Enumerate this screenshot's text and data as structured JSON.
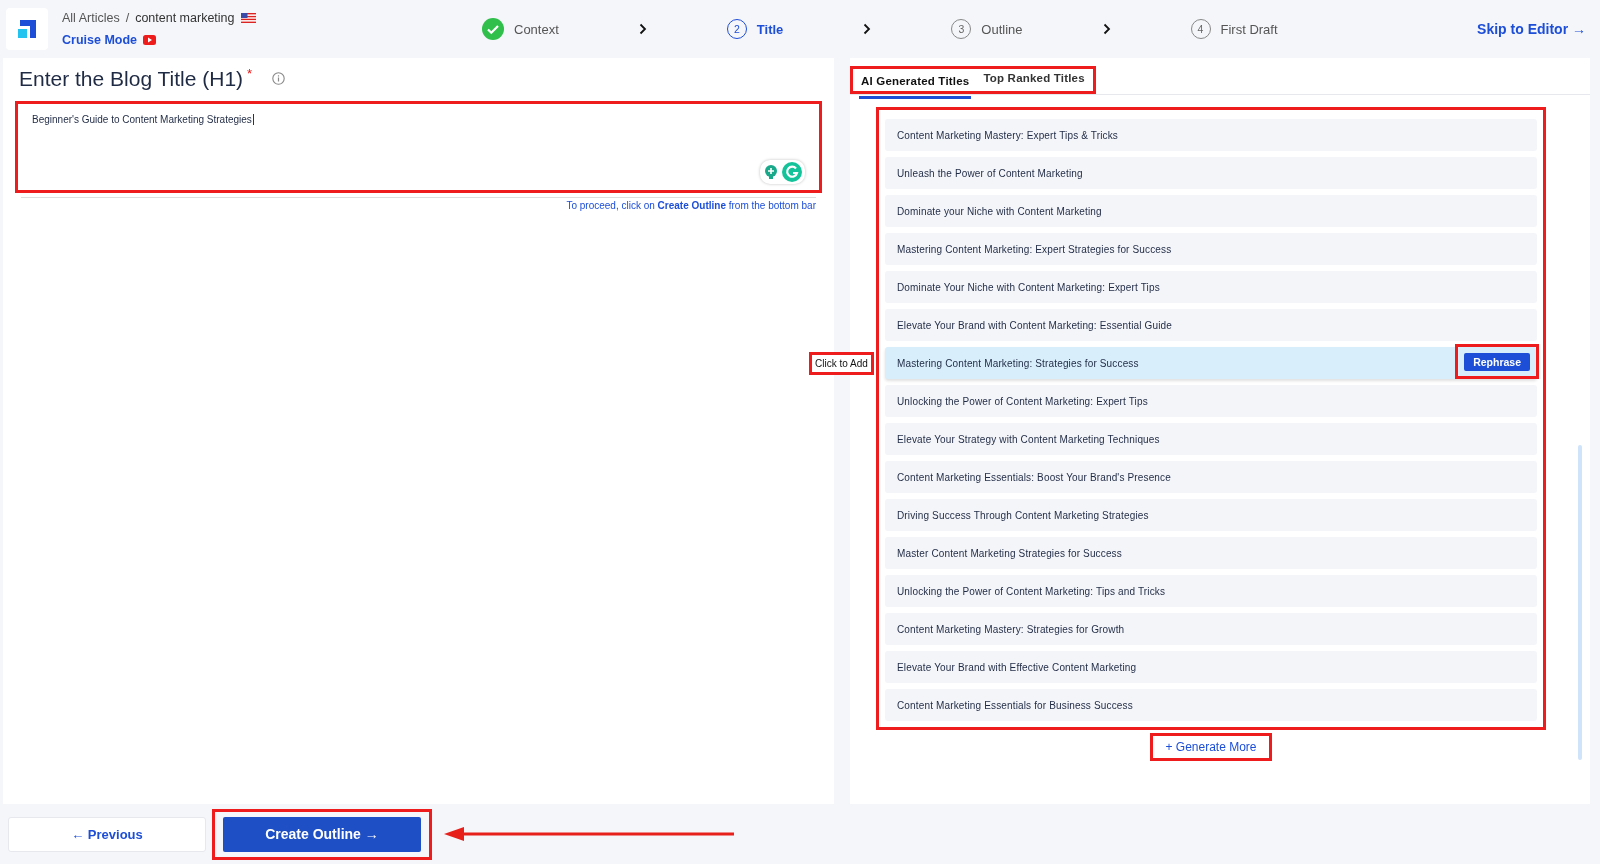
{
  "breadcrumb": {
    "parent": "All Articles",
    "separator": "/",
    "current": "content marketing"
  },
  "cruise_mode": "Cruise Mode",
  "steps": [
    {
      "label": "Context",
      "done": true,
      "active": false
    },
    {
      "number": "2",
      "label": "Title",
      "done": false,
      "active": true
    },
    {
      "number": "3",
      "label": "Outline",
      "done": false,
      "active": false
    },
    {
      "number": "4",
      "label": "First Draft",
      "done": false,
      "active": false
    }
  ],
  "skip_link": "Skip to Editor →",
  "editor": {
    "heading": "Enter the Blog Title (H1)",
    "required_mark": "*",
    "value": "Beginner's Guide to Content Marketing Strategies",
    "hint": "To proceed, click on **Create Outline** from the bottom bar"
  },
  "tabs": [
    {
      "label": "AI Generated Titles",
      "selected": true
    },
    {
      "label": "Top Ranked Titles",
      "selected": false
    }
  ],
  "titles": [
    {
      "text": "Content Marketing Mastery: Expert Tips & Tricks",
      "selected": false
    },
    {
      "text": "Unleash the Power of Content Marketing",
      "selected": false
    },
    {
      "text": "Dominate your Niche with Content Marketing",
      "selected": false
    },
    {
      "text": "Mastering Content Marketing: Expert Strategies for Success",
      "selected": false
    },
    {
      "text": "Dominate Your Niche with Content Marketing: Expert Tips",
      "selected": false
    },
    {
      "text": "Elevate Your Brand with Content Marketing: Essential Guide",
      "selected": false
    },
    {
      "text": "Mastering Content Marketing: Strategies for Success",
      "selected": true
    },
    {
      "text": "Unlocking the Power of Content Marketing: Expert Tips",
      "selected": false
    },
    {
      "text": "Elevate Your Strategy with Content Marketing Techniques",
      "selected": false
    },
    {
      "text": "Content Marketing Essentials: Boost Your Brand's Presence",
      "selected": false
    },
    {
      "text": "Driving Success Through Content Marketing Strategies",
      "selected": false
    },
    {
      "text": "Master Content Marketing Strategies for Success",
      "selected": false
    },
    {
      "text": "Unlocking the Power of Content Marketing: Tips and Tricks",
      "selected": false
    },
    {
      "text": "Content Marketing Mastery: Strategies for Growth",
      "selected": false
    },
    {
      "text": "Elevate Your Brand with Effective Content Marketing",
      "selected": false
    },
    {
      "text": "Content Marketing Essentials for Business Success",
      "selected": false
    }
  ],
  "rephrase_button": "Rephrase",
  "tooltip": "Click to Add",
  "generate_more": "+ Generate More",
  "previous_button": "← Previous",
  "create_outline_button": "Create Outline →"
}
